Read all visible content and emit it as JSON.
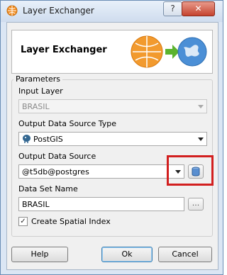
{
  "window": {
    "title": "Layer Exchanger",
    "help_glyph": "?",
    "close_glyph": "✕"
  },
  "banner": {
    "title": "Layer Exchanger"
  },
  "parameters": {
    "group_title": "Parameters",
    "input_layer_label": "Input Layer",
    "input_layer_value": "BRASIL",
    "output_type_label": "Output Data Source Type",
    "output_type_value": "PostGIS",
    "output_source_label": "Output Data Source",
    "output_source_value": "@t5db@postgres",
    "dataset_name_label": "Data Set Name",
    "dataset_name_value": "BRASIL",
    "browse_label": "...",
    "spatial_index_label": "Create Spatial Index",
    "spatial_index_checked": true
  },
  "buttons": {
    "help": "Help",
    "ok": "Ok",
    "cancel": "Cancel"
  },
  "colors": {
    "highlight": "#d21f1f",
    "accent": "#3c7fb1"
  }
}
